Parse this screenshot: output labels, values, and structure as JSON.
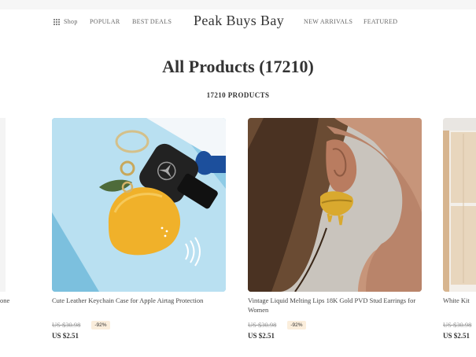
{
  "nav": {
    "shop_label": "Shop",
    "popular_label": "POPULAR",
    "best_deals_label": "BEST DEALS",
    "brand": "Peak Buys Bay",
    "new_arrivals_label": "NEW ARRIVALS",
    "featured_label": "FEATURED"
  },
  "page": {
    "title_main": "All Products",
    "title_count": "(17210)",
    "product_count_label": "17210 PRODUCTS"
  },
  "products": [
    {
      "title": "Cute Leather Keychain Case for Apple Airtag Protection",
      "old_price": "US $30.98",
      "discount": "-92%",
      "price": "US $2.51"
    },
    {
      "title": "Vintage Liquid Melting Lips 18K Gold PVD Stud Earrings for Women",
      "old_price": "US $30.98",
      "discount": "-92%",
      "price": "US $2.51"
    },
    {
      "title": "White Kit",
      "old_price": "US $30.98",
      "price": "US $2.51"
    }
  ],
  "partial_left": {
    "title_fragment": "one"
  },
  "icons": {
    "shop": "grid-icon"
  }
}
